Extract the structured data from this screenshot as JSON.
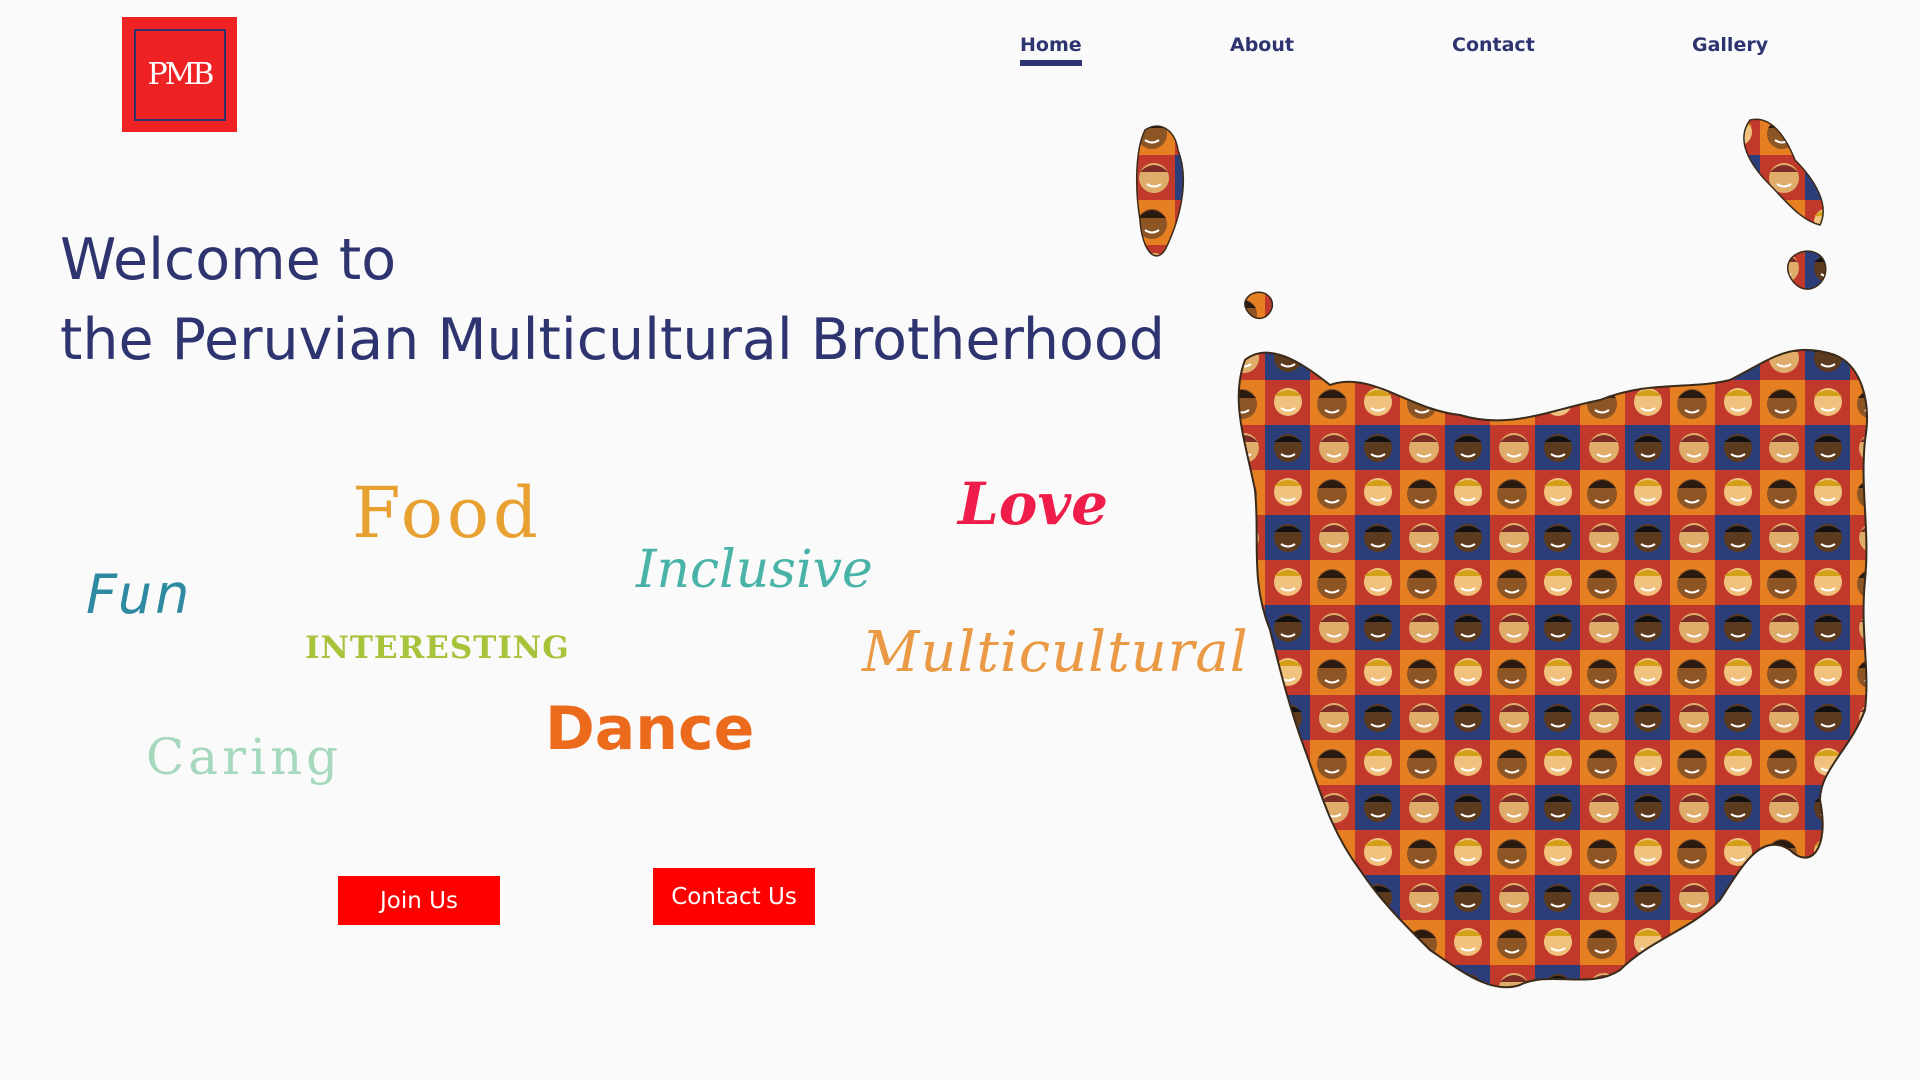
{
  "logo": {
    "text": "PMB"
  },
  "nav": {
    "items": [
      {
        "label": "Home",
        "active": true
      },
      {
        "label": "About",
        "active": false
      },
      {
        "label": "Contact",
        "active": false
      },
      {
        "label": "Gallery",
        "active": false
      }
    ]
  },
  "hero": {
    "line1": "Welcome to",
    "line2": "the Peruvian Multicultural Brotherhood"
  },
  "words": {
    "food": "Food",
    "fun": "Fun",
    "inclusive": "Inclusive",
    "love": "Love",
    "interesting": "INTERESTING",
    "multicultural": "Multicultural",
    "dance": "Dance",
    "caring": "Caring"
  },
  "buttons": {
    "join": "Join Us",
    "contact": "Contact Us"
  },
  "colors": {
    "brand_navy": "#2e3470",
    "brand_red": "#ee2222",
    "button_red": "#ff0000",
    "background": "#fafafa"
  },
  "illustration": {
    "name": "tasmania-map-of-diverse-faces"
  }
}
